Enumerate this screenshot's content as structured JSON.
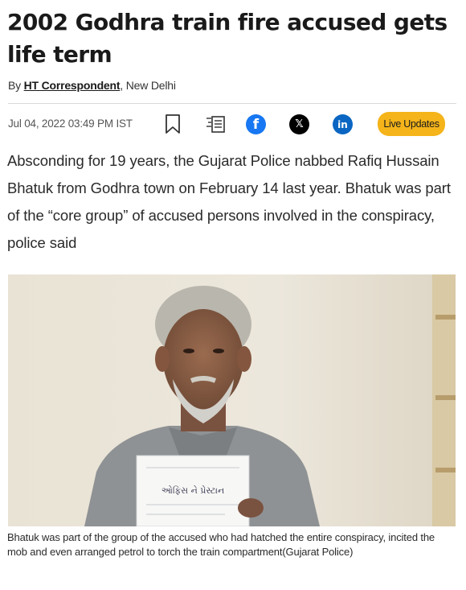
{
  "article": {
    "headline": "2002 Godhra train fire accused gets life term",
    "byline_prefix": "By ",
    "author": "HT Correspondent",
    "location": ", New Delhi",
    "dateline": "Jul 04, 2022 03:49 PM IST",
    "summary": "Absconding for 19 years, the Gujarat Police nabbed Rafiq Hussain Bhatuk from Godhra town on February 14 last year. Bhatuk was part of the “core group” of accused persons involved in the conspiracy, police said",
    "caption": "Bhatuk was part of the group of the accused who had hatched the entire conspiracy, incited the mob and even arranged petrol to torch the train compartment(Gujarat Police)"
  },
  "actions": {
    "live_updates_label": "Live Updates",
    "icons": [
      "bookmark-icon",
      "share-doc-icon",
      "facebook-icon",
      "x-icon",
      "linkedin-icon"
    ],
    "facebook_glyph": "f",
    "x_glyph": "𝕏",
    "linkedin_glyph": "in"
  },
  "photo": {
    "placard_text": "ઓફિસ ને પ્રેસ્ટાન"
  },
  "colors": {
    "facebook": "#1877f2",
    "x": "#000000",
    "linkedin": "#0a66c2",
    "live_updates": "#f4b41a"
  }
}
